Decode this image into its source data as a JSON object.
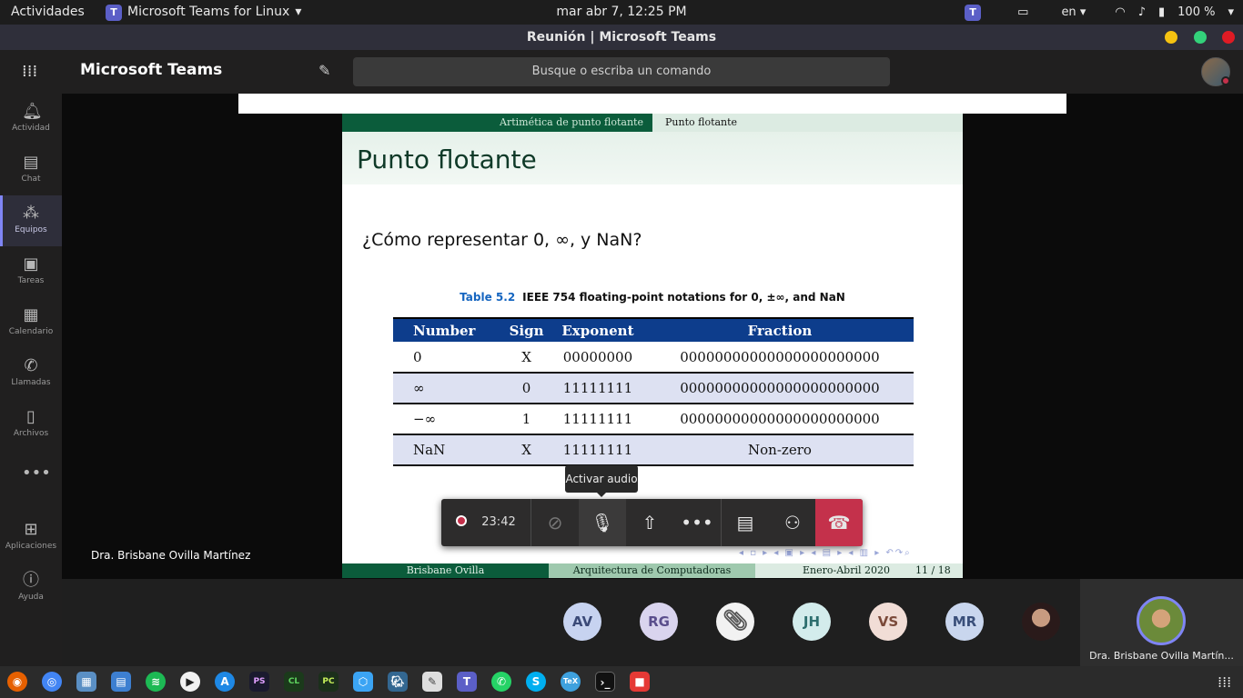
{
  "topbar": {
    "activities": "Actividades",
    "app_name": "Microsoft Teams for Linux",
    "clock": "mar abr  7, 12:25 PM",
    "lang": "en",
    "battery": "100 %"
  },
  "window": {
    "title": "Reunión | Microsoft Teams"
  },
  "header": {
    "brand": "Microsoft Teams",
    "search_placeholder": "Busque o escriba un comando"
  },
  "rail": {
    "items": [
      {
        "label": "Actividad",
        "icon": "bell-icon"
      },
      {
        "label": "Chat",
        "icon": "chat-icon"
      },
      {
        "label": "Equipos",
        "icon": "teams-icon"
      },
      {
        "label": "Tareas",
        "icon": "tasks-icon"
      },
      {
        "label": "Calendario",
        "icon": "calendar-icon"
      },
      {
        "label": "Llamadas",
        "icon": "phone-icon"
      },
      {
        "label": "Archivos",
        "icon": "file-icon"
      },
      {
        "label": "Aplicaciones",
        "icon": "apps-icon"
      },
      {
        "label": "Ayuda",
        "icon": "help-icon"
      }
    ],
    "more": "•••"
  },
  "slide": {
    "nav_section": "Artimética de punto flotante",
    "nav_subsection": "Punto flotante",
    "title": "Punto flotante",
    "question": "¿Cómo representar 0, ∞, y NaN?",
    "table_label": "Table 5.2",
    "table_caption": "IEEE 754 floating-point notations for 0, ±∞, and NaN",
    "columns": [
      "Number",
      "Sign",
      "Exponent",
      "Fraction"
    ],
    "rows": [
      [
        "0",
        "X",
        "00000000",
        "00000000000000000000000"
      ],
      [
        "∞",
        "0",
        "11111111",
        "00000000000000000000000"
      ],
      [
        "−∞",
        "1",
        "11111111",
        "00000000000000000000000"
      ],
      [
        "NaN",
        "X",
        "11111111",
        "Non-zero"
      ]
    ],
    "footer_author": "Brisbane Ovilla",
    "footer_course": "Arquitectura de Computadoras",
    "footer_date": "Enero-Abril 2020",
    "footer_page": "11 / 18"
  },
  "meeting": {
    "presenter": "Dra. Brisbane Ovilla Martínez",
    "tooltip": "Activar audio",
    "timer": "23:42"
  },
  "participants": [
    {
      "initials": "AV",
      "bg": "#c7d3f0",
      "fg": "#3b4a78"
    },
    {
      "initials": "RG",
      "bg": "#d9d4ee",
      "fg": "#5a4e8c"
    },
    {
      "initials": "",
      "bg": "#f2f2f2",
      "fg": "#555"
    },
    {
      "initials": "JH",
      "bg": "#d3ecec",
      "fg": "#2d6e6e"
    },
    {
      "initials": "VS",
      "bg": "#f1ddd6",
      "fg": "#7b4a3a"
    },
    {
      "initials": "MR",
      "bg": "#c9d6ee",
      "fg": "#3a4f7a"
    }
  ],
  "self_name": "Dra. Brisbane Ovilla Martín..."
}
